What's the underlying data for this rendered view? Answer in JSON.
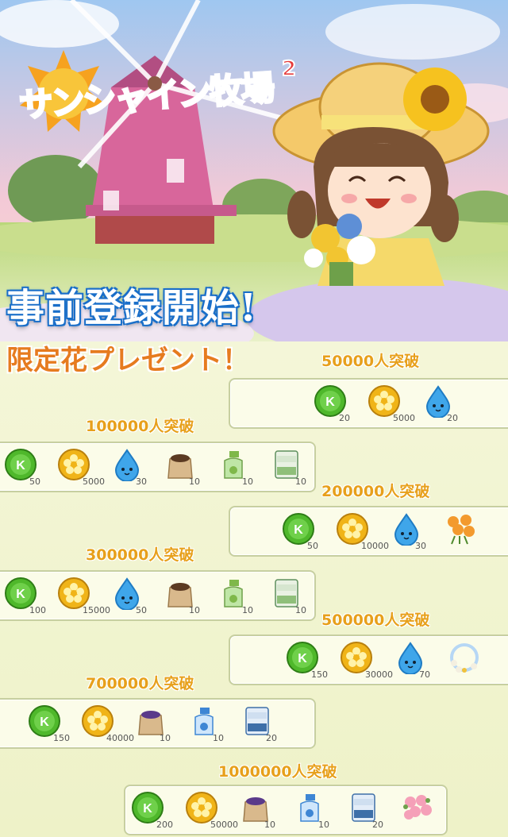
{
  "logo": {
    "title": "サンシャイン牧場",
    "edition": "2"
  },
  "headline": "事前登録開始!",
  "subhead": "限定花プレゼント！",
  "colors": {
    "accent_gold": "#e7a01b",
    "headline_blue": "#1a6fc9",
    "subhead_orange": "#e67b1f",
    "panel_border": "#c7cfa0"
  },
  "tiers": [
    {
      "label": "50000人突破",
      "rewards": [
        {
          "icon": "k-coin-icon",
          "qty": "20"
        },
        {
          "icon": "gold-flower-coin-icon",
          "qty": "5000"
        },
        {
          "icon": "water-drop-icon",
          "qty": "20"
        }
      ]
    },
    {
      "label": "100000人突破",
      "rewards": [
        {
          "icon": "k-coin-icon",
          "qty": "50"
        },
        {
          "icon": "gold-flower-coin-icon",
          "qty": "5000"
        },
        {
          "icon": "water-drop-icon",
          "qty": "30"
        },
        {
          "icon": "soil-bag-icon",
          "qty": "10"
        },
        {
          "icon": "spray-bottle-green-icon",
          "qty": "10"
        },
        {
          "icon": "fertilizer-bag-green-icon",
          "qty": "10"
        }
      ]
    },
    {
      "label": "200000人突破",
      "rewards": [
        {
          "icon": "k-coin-icon",
          "qty": "50"
        },
        {
          "icon": "gold-flower-coin-icon",
          "qty": "10000"
        },
        {
          "icon": "water-drop-icon",
          "qty": "30"
        },
        {
          "icon": "orange-lily-flower-icon",
          "qty": ""
        }
      ]
    },
    {
      "label": "300000人突破",
      "rewards": [
        {
          "icon": "k-coin-icon",
          "qty": "100"
        },
        {
          "icon": "gold-flower-coin-icon",
          "qty": "15000"
        },
        {
          "icon": "water-drop-icon",
          "qty": "50"
        },
        {
          "icon": "soil-bag-icon",
          "qty": "10"
        },
        {
          "icon": "spray-bottle-green-icon",
          "qty": "10"
        },
        {
          "icon": "fertilizer-bag-green-icon",
          "qty": "10"
        }
      ]
    },
    {
      "label": "500000人突破",
      "rewards": [
        {
          "icon": "k-coin-icon",
          "qty": "150"
        },
        {
          "icon": "gold-flower-coin-icon",
          "qty": "30000"
        },
        {
          "icon": "water-drop-icon",
          "qty": "70"
        },
        {
          "icon": "flower-wreath-icon",
          "qty": ""
        }
      ]
    },
    {
      "label": "700000人突破",
      "rewards": [
        {
          "icon": "k-coin-icon",
          "qty": "150"
        },
        {
          "icon": "gold-flower-coin-icon",
          "qty": "40000"
        },
        {
          "icon": "purple-soil-bag-icon",
          "qty": "10"
        },
        {
          "icon": "spray-bottle-blue-icon",
          "qty": "10"
        },
        {
          "icon": "fertilizer-bag-blue-icon",
          "qty": "20"
        }
      ]
    },
    {
      "label": "1000000人突破",
      "rewards": [
        {
          "icon": "k-coin-icon",
          "qty": "200"
        },
        {
          "icon": "gold-flower-coin-icon",
          "qty": "50000"
        },
        {
          "icon": "purple-soil-bag-icon",
          "qty": "10"
        },
        {
          "icon": "spray-bottle-blue-icon",
          "qty": "10"
        },
        {
          "icon": "fertilizer-bag-blue-icon",
          "qty": "20"
        },
        {
          "icon": "pink-rose-bouquet-icon",
          "qty": ""
        }
      ]
    }
  ]
}
